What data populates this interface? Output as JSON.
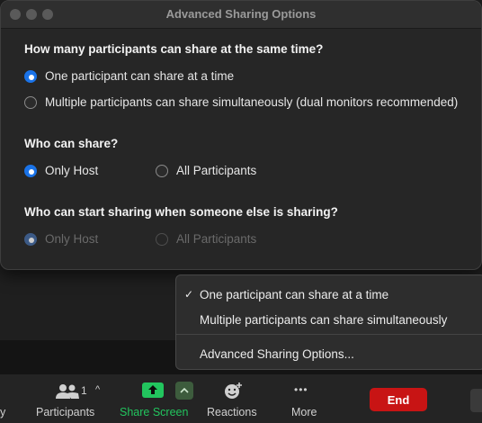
{
  "dialog": {
    "title": "Advanced Sharing Options",
    "sections": [
      {
        "title": "How many participants can share at the same time?",
        "options": [
          {
            "label": "One participant can share at a time",
            "checked": true
          },
          {
            "label": "Multiple participants can share simultaneously (dual monitors recommended)",
            "checked": false
          }
        ]
      },
      {
        "title": "Who can share?",
        "options": [
          {
            "label": "Only Host",
            "checked": true
          },
          {
            "label": "All Participants",
            "checked": false
          }
        ]
      },
      {
        "title": "Who can start sharing when someone else is sharing?",
        "disabled": true,
        "options": [
          {
            "label": "Only Host",
            "checked": true
          },
          {
            "label": "All Participants",
            "checked": false
          }
        ]
      }
    ]
  },
  "menu": {
    "items": [
      {
        "label": "One participant can share at a time",
        "checked": true
      },
      {
        "label": "Multiple participants can share simultaneously",
        "checked": false
      },
      {
        "label": "Advanced Sharing Options...",
        "checked": false
      }
    ]
  },
  "toolbar": {
    "partial_left": "y",
    "participants_count": "1",
    "participants_label": "Participants",
    "share_label": "Share Screen",
    "reactions_label": "Reactions",
    "more_label": "More",
    "end_label": "End",
    "accent_green": "#22c55e",
    "end_color": "#c81414"
  },
  "icons": {
    "check": "✓",
    "caret_up": "^",
    "more": "•••"
  }
}
